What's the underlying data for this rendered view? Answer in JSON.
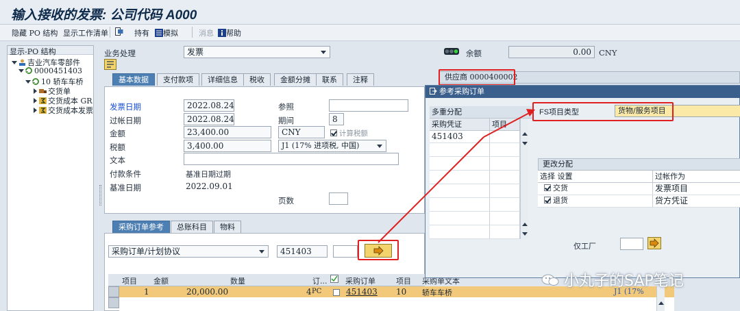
{
  "window": {
    "title": "输入接收的发票: 公司代码 A000"
  },
  "toolbar": {
    "hide_po_structure": "隐藏 PO 结构",
    "show_worklist": "显示工作清单",
    "hold": "持有",
    "simulate": "模拟",
    "messages": "消息",
    "help": "帮助"
  },
  "tree": {
    "header": "显示-PO 结构",
    "vendor": "吉业汽车零部件",
    "po": "0000451403",
    "item": "10 轿车车桥",
    "children": [
      "交货单",
      "交货成本 GR",
      "交货成本发票"
    ]
  },
  "header": {
    "transaction_label": "业务处理",
    "transaction_value": "发票",
    "balance_label": "余额",
    "balance_value": "0.00",
    "balance_currency": "CNY"
  },
  "tabs": [
    "基本数据",
    "支付款项",
    "详细信息",
    "税收",
    "金额分摊",
    "联系",
    "注释"
  ],
  "vendor_bar": {
    "text": "供应商 0000400002"
  },
  "basic": {
    "invoice_date_label": "发票日期",
    "invoice_date": "2022.08.24",
    "reference_label": "参照",
    "posting_date_label": "过帐日期",
    "posting_date": "2022.08.24",
    "period_label": "期间",
    "period": "8",
    "amount_label": "金额",
    "amount": "23,400.00",
    "currency": "CNY",
    "calc_tax_label": "计算税额",
    "tax_label": "税额",
    "tax_amount": "3,400.00",
    "tax_code": "J1 (17% 进项税, 中国)",
    "text_label": "文本",
    "payment_terms_label": "付款条件",
    "payment_terms_value": "基准日期过期",
    "baseline_date_label": "基准日期",
    "baseline_date": "2022.09.01",
    "pages_label": "页数"
  },
  "bottom_tabs": [
    "采购订单参考",
    "总账科目",
    "物料"
  ],
  "po_ref": {
    "type_value": "采购订单/计划协议",
    "po_number": "451403"
  },
  "item_table": {
    "headers": [
      "项目",
      "金额",
      "数量",
      "订...",
      "采购订单",
      "项目",
      "采购单文本"
    ],
    "row": {
      "item": "1",
      "amount": "20,000.00",
      "quantity": "4",
      "unit": "PC",
      "po": "451403",
      "po_item": "10",
      "text": "轿车车桥",
      "tax": "J1 (17%"
    }
  },
  "dialog": {
    "title": "参考采购订单",
    "multi_assign_label": "多重分配",
    "col_po": "采购凭证",
    "col_item": "项目",
    "po_value": "451403",
    "fs_type_label": "FS项目类型",
    "fs_type_value": "货物/服务项目",
    "change_assign_label": "更改分配",
    "col_select": "选择",
    "col_setting": "设置",
    "col_post_as": "过帐作为",
    "rows": [
      {
        "setting": "交货",
        "post_as": "发票项目"
      },
      {
        "setting": "退货",
        "post_as": "贷方凭证"
      }
    ],
    "only_plant_label": "仅工厂"
  },
  "watermark": "小丸子的SAP笔记",
  "colors": {
    "accent": "#4d7fb3",
    "highlight_box": "#e02020",
    "field_yellow": "#fbe9a8"
  }
}
